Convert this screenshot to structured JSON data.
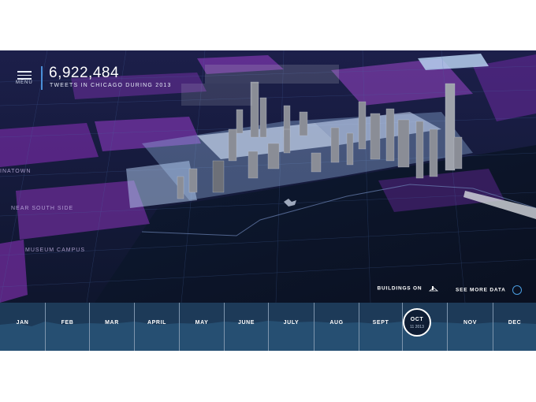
{
  "header": {
    "menu_label": "MENU",
    "tweet_count": "6,922,484",
    "tweet_caption": "TWEETS IN CHICAGO DURING 2013"
  },
  "map_labels": [
    "NEAR SOUTH SIDE",
    "MUSEUM CAMPUS",
    "INATOWN"
  ],
  "controls": {
    "buildings_label": "BUILDINGS ON",
    "more_data_label": "SEE MORE DATA"
  },
  "timeline": {
    "months": [
      "JAN",
      "FEB",
      "MAR",
      "APRIL",
      "MAY",
      "JUNE",
      "JULY",
      "AUG",
      "SEPT",
      "OCT",
      "NOV",
      "DEC"
    ],
    "selected_month": "OCT",
    "selected_date": "11 2013"
  },
  "colors": {
    "background": "#0b1224",
    "accent": "#4a8fd8",
    "district_purple": "#7a2fa8",
    "timeline": "#1d3a58"
  }
}
